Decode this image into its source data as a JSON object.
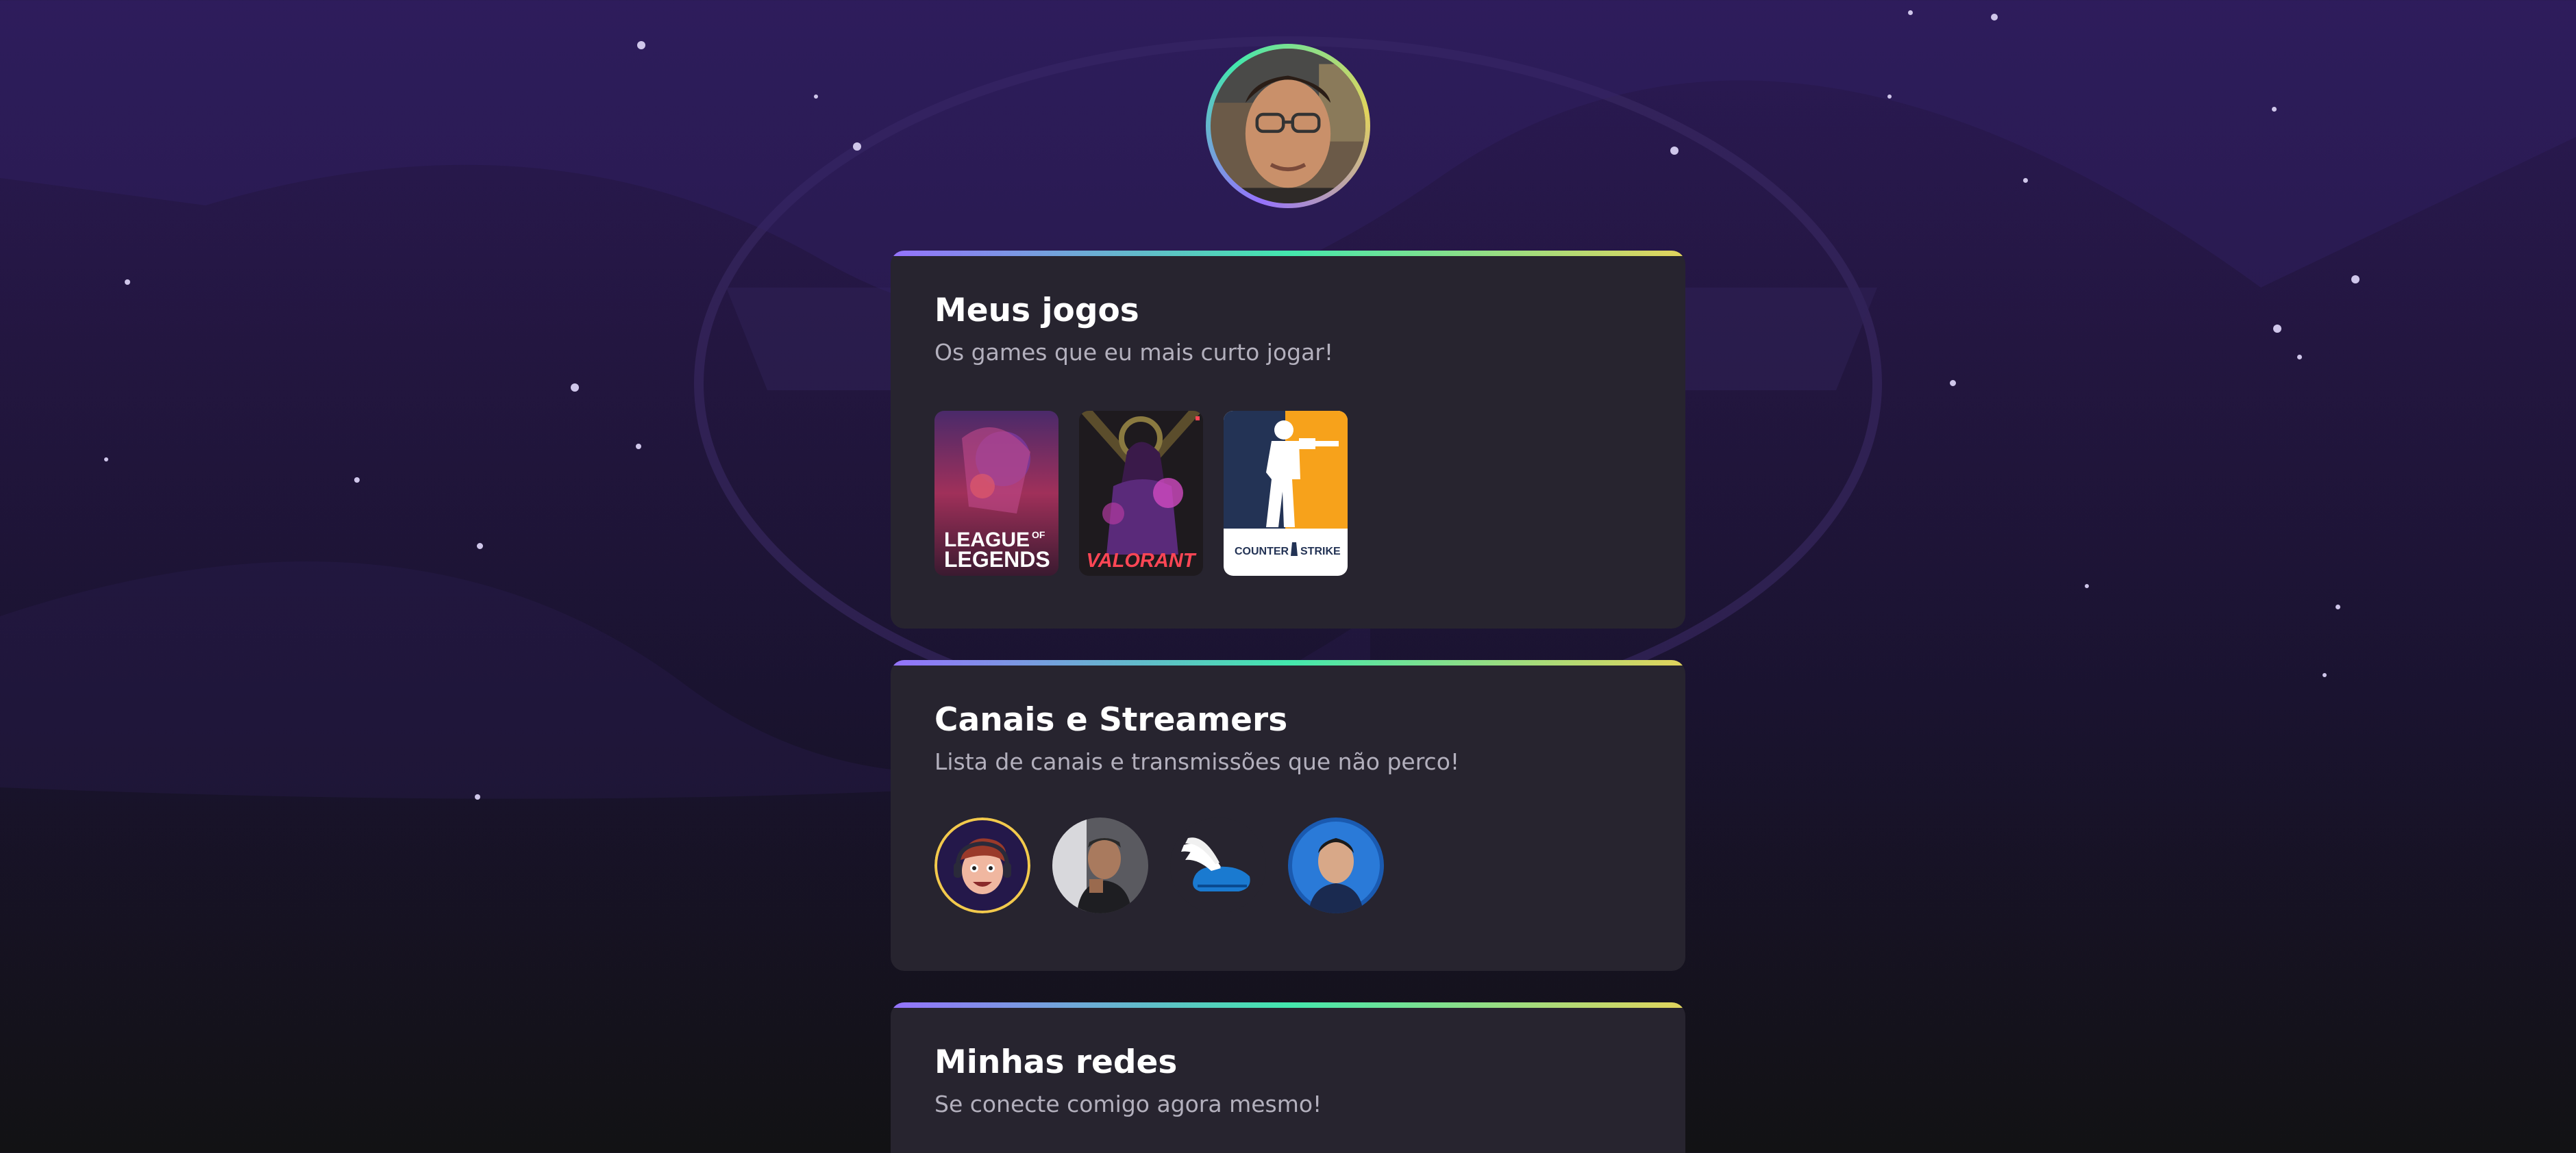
{
  "profile": {
    "avatar_alt": "Foto de perfil"
  },
  "games_section": {
    "title": "Meus jogos",
    "subtitle": "Os games que eu mais curto jogar!",
    "games": [
      {
        "name": "League of Legends",
        "logo_line1": "LEAGUE",
        "logo_of": "OF",
        "logo_line2": "LEGENDS"
      },
      {
        "name": "Valorant",
        "logo": "VALORANT"
      },
      {
        "name": "Counter-Strike",
        "logo_a": "COUNTER",
        "logo_b": "STRIKE"
      }
    ]
  },
  "channels_section": {
    "title": "Canais e Streamers",
    "subtitle": "Lista de canais e transmissões que não perco!",
    "channels": [
      {
        "icon": "cartoon-streamer-avatar"
      },
      {
        "icon": "streamer-photo-avatar"
      },
      {
        "icon": "winged-shoe-logo"
      },
      {
        "icon": "blue-background-person-avatar"
      }
    ]
  },
  "social_section": {
    "title": "Minhas redes",
    "subtitle": "Se conecte comigo agora mesmo!"
  },
  "colors": {
    "gradient_start": "#9572fc",
    "gradient_mid": "#43e7ad",
    "gradient_end": "#e2d45c",
    "card_bg": "#27242f"
  }
}
